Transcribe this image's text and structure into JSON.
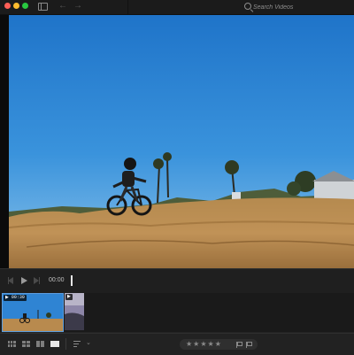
{
  "titlebar": {
    "search_placeholder": "Search Videos"
  },
  "icons": {
    "close": "close-window-icon",
    "minimize": "minimize-window-icon",
    "zoom": "zoom-window-icon",
    "sidebar": "sidebar-toggle-icon",
    "back": "back-arrow-icon",
    "forward": "forward-arrow-icon",
    "search": "search-icon"
  },
  "viewer": {
    "content": "video-frame"
  },
  "transport": {
    "timecode": "00:00",
    "icons": [
      "skip-back-icon",
      "play-icon",
      "skip-forward-icon"
    ]
  },
  "filmstrip": {
    "clips": [
      {
        "badge": "▶ 00:39",
        "selected": true
      },
      {
        "badge": "▶",
        "selected": false
      }
    ]
  },
  "toolbar": {
    "view_icons": [
      "grid-small-icon",
      "grid-medium-icon",
      "grid-large-icon",
      "single-view-icon"
    ],
    "rating": "★★★★★",
    "selected_view": "single"
  },
  "colors": {
    "accent": "#5b9ddf",
    "close": "#ff5f57",
    "minimize": "#febc2e",
    "zoom": "#28c840"
  }
}
